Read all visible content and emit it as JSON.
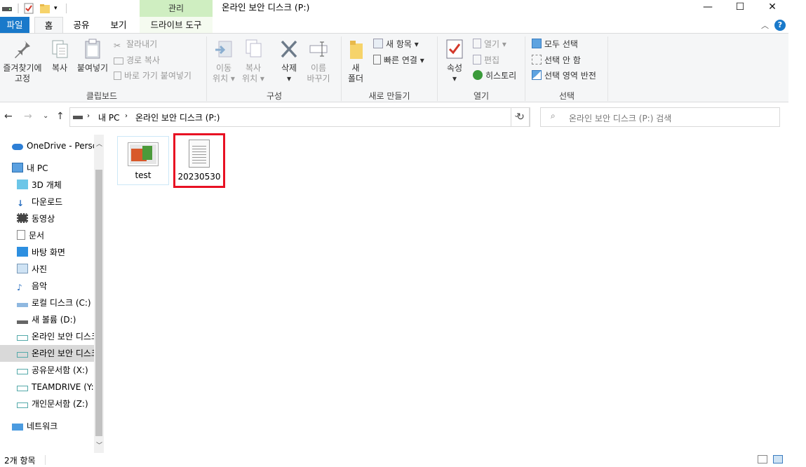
{
  "titlebar": {
    "title": "온라인 보안 디스크 (P:)",
    "context_tab": "관리",
    "minimize": "—",
    "maximize": "☐",
    "close": "✕"
  },
  "tabs": {
    "file": "파일",
    "home": "홈",
    "share": "공유",
    "view": "보기",
    "drive_tools": "드라이브 도구"
  },
  "ribbon": {
    "clipboard": {
      "label": "클립보드",
      "pin_line1": "즐겨찾기에",
      "pin_line2": "고정",
      "copy": "복사",
      "paste": "붙여넣기",
      "cut": "잘라내기",
      "copy_path": "경로 복사",
      "paste_shortcut": "바로 가기 붙여넣기"
    },
    "organize": {
      "label": "구성",
      "move_line1": "이동",
      "move_line2": "위치 ▾",
      "copyto_line1": "복사",
      "copyto_line2": "위치 ▾",
      "delete": "삭제",
      "delete_arrow": "▾",
      "rename_line1": "이름",
      "rename_line2": "바꾸기"
    },
    "new": {
      "label": "새로 만들기",
      "new_folder_line1": "새",
      "new_folder_line2": "폴더",
      "new_item": "새 항목 ▾",
      "easy_access": "빠른 연결 ▾"
    },
    "open": {
      "label": "열기",
      "properties": "속성",
      "properties_arrow": "▾",
      "open": "열기 ▾",
      "edit": "편집",
      "history": "히스토리"
    },
    "select": {
      "label": "선택",
      "select_all": "모두 선택",
      "select_none": "선택 안 함",
      "invert": "선택 영역 반전"
    }
  },
  "address": {
    "pc": "내 PC",
    "drive": "온라인 보안 디스크 (P:)",
    "search_placeholder": "온라인 보안 디스크 (P:) 검색"
  },
  "navpane": {
    "onedrive": "OneDrive - Personal",
    "this_pc": "내 PC",
    "items": [
      "3D 개체",
      "다운로드",
      "동영상",
      "문서",
      "바탕 화면",
      "사진",
      "음악",
      "로컬 디스크 (C:)",
      "새 볼륨 (D:)",
      "온라인 보안 디스크",
      "온라인 보안 디스크 (P:)",
      "공유문서함 (X:)",
      "TEAMDRIVE (Y:)",
      "개인문서함 (Z:)"
    ],
    "network": "네트워크"
  },
  "files": [
    {
      "name": "test"
    },
    {
      "name": "20230530"
    }
  ],
  "status": {
    "count": "2개 항목"
  },
  "colors": {
    "accent": "#1979ca",
    "highlight_box": "#e81123",
    "manage_tab": "#cfeec1"
  }
}
